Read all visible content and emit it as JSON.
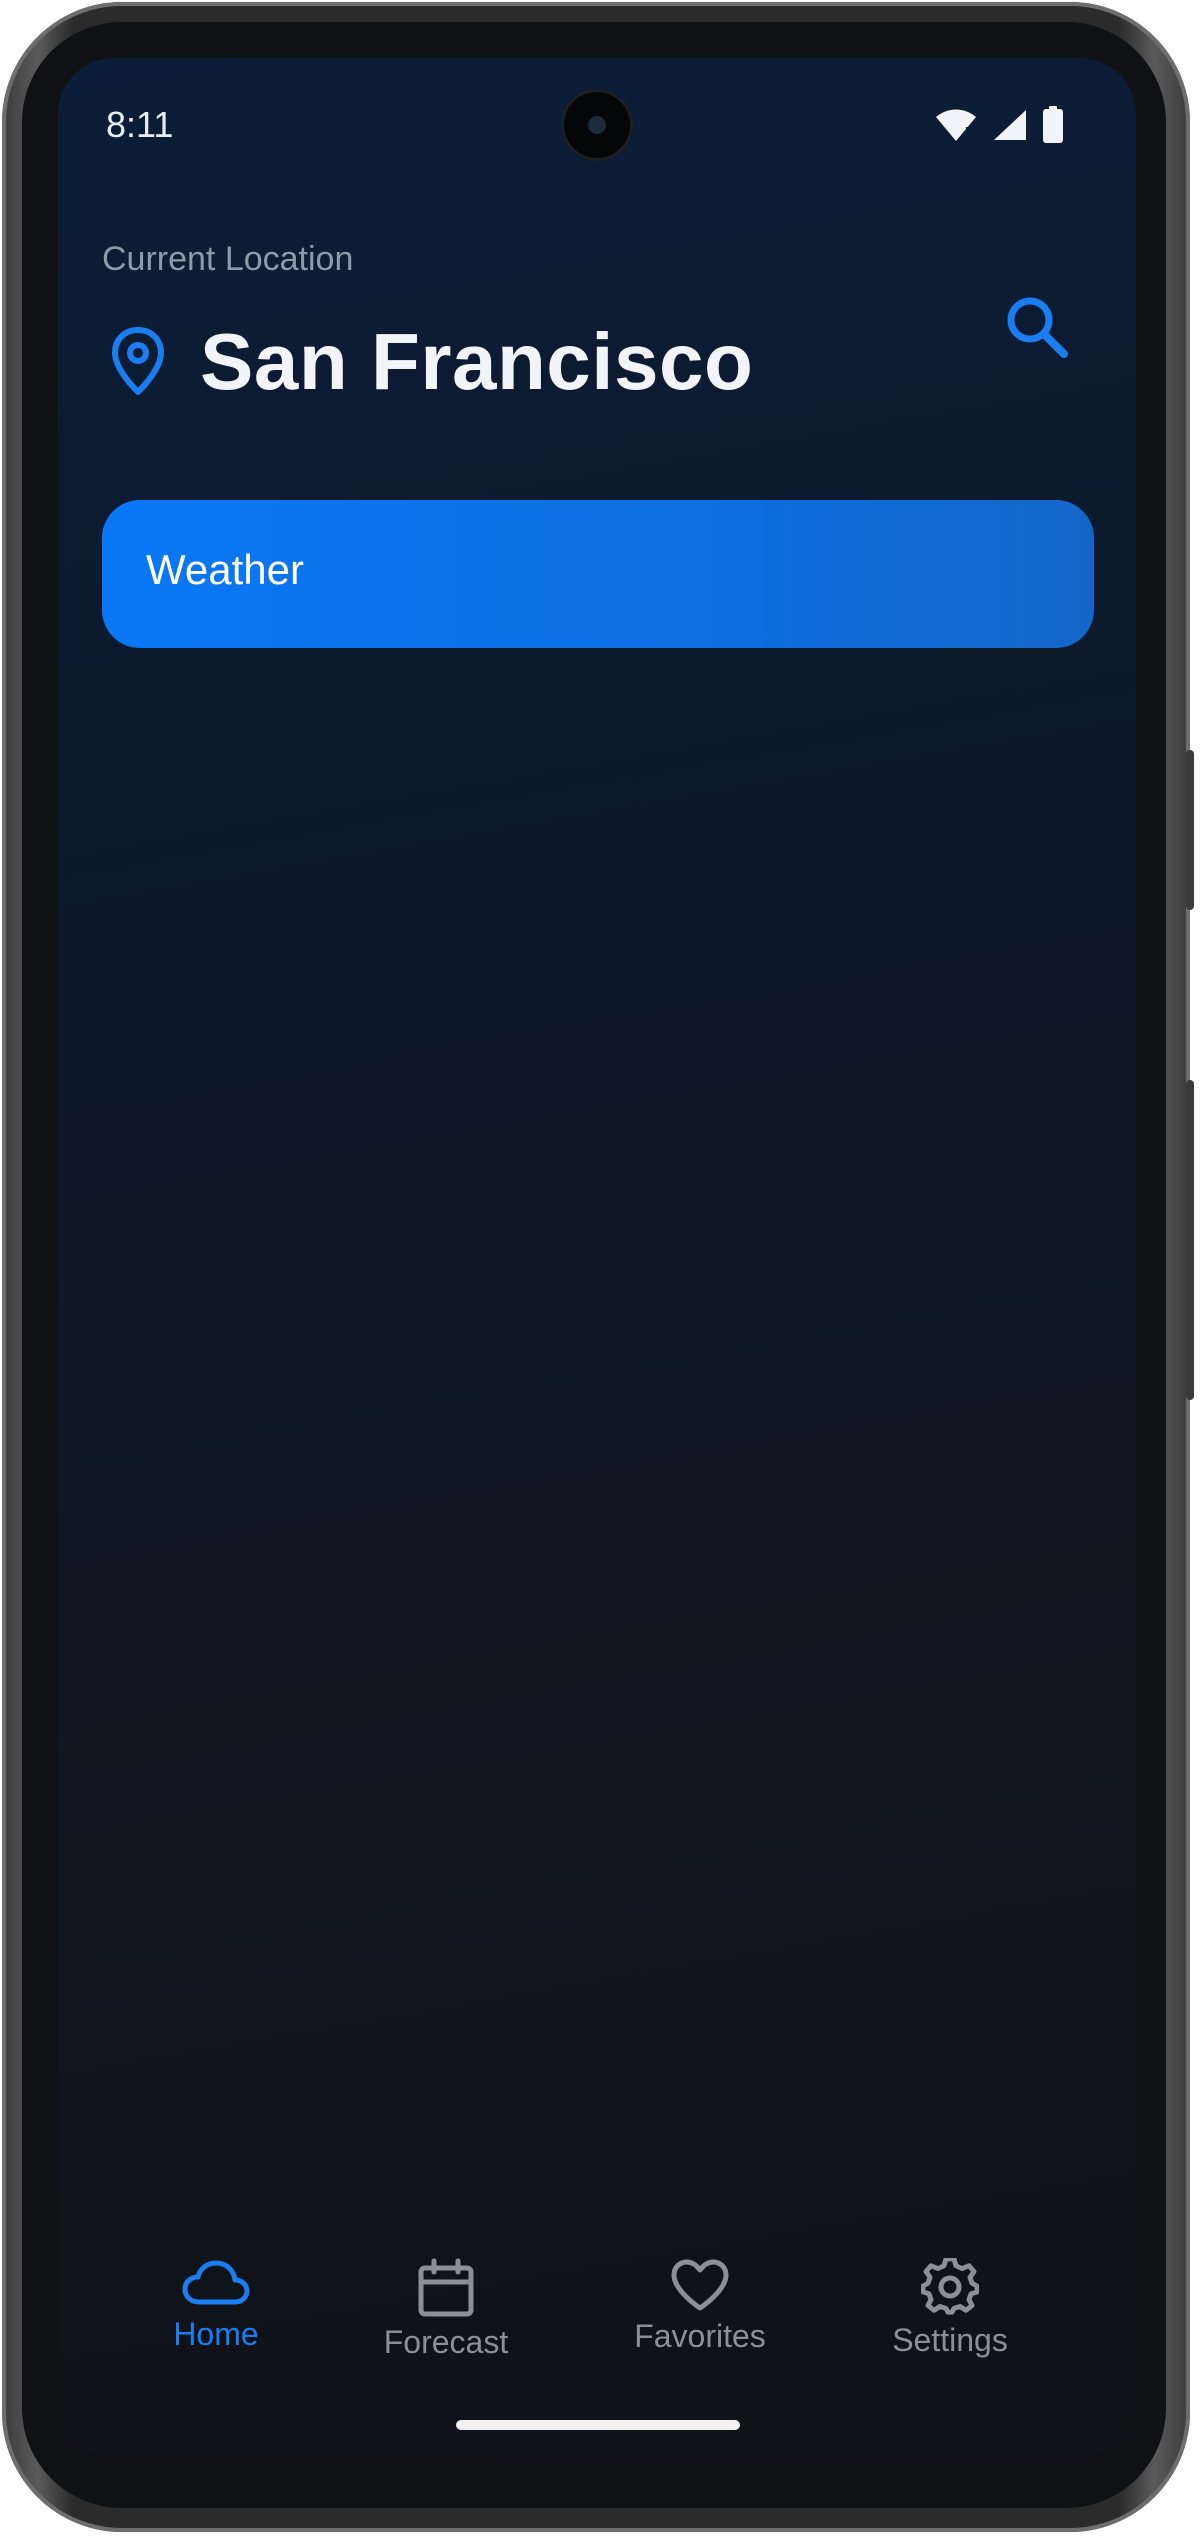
{
  "status_bar": {
    "time": "8:11",
    "icons": [
      "wifi-icon",
      "signal-icon",
      "battery-icon"
    ]
  },
  "header": {
    "subtitle": "Current Location",
    "city": "San Francisco",
    "location_icon": "map-pin-icon",
    "search_icon": "search-icon"
  },
  "card": {
    "label": "Weather"
  },
  "bottom_nav": {
    "items": [
      {
        "label": "Home",
        "icon": "cloud-icon",
        "active": true
      },
      {
        "label": "Forecast",
        "icon": "calendar-icon",
        "active": false
      },
      {
        "label": "Favorites",
        "icon": "heart-icon",
        "active": false
      },
      {
        "label": "Settings",
        "icon": "gear-icon",
        "active": false
      }
    ]
  },
  "colors": {
    "accent": "#1a7ef0",
    "background_top": "#0b1d38",
    "background_bottom": "#0f1216",
    "inactive": "#8b8f96"
  }
}
